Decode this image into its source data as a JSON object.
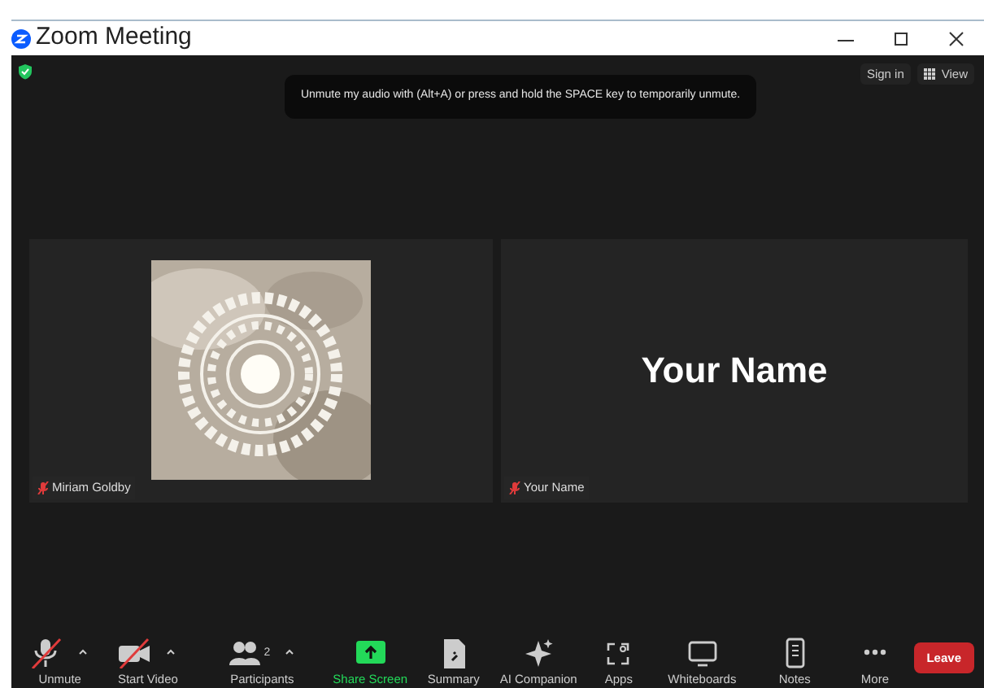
{
  "window": {
    "title": "Zoom Meeting"
  },
  "top_bar": {
    "encrypted": true,
    "sign_in": "Sign in",
    "view": "View"
  },
  "banner": "Unmute my audio with (Alt+A) or press and hold the SPACE key to temporarily unmute.",
  "tiles": [
    {
      "kind": "picture",
      "name": "Miriam Goldby",
      "muted": true
    },
    {
      "kind": "name",
      "display_name": "Your Name",
      "name": "Your Name",
      "muted": true
    }
  ],
  "toolbar": [
    {
      "kind": "mic",
      "label": "Unmute",
      "off": true,
      "has_menu": true
    },
    {
      "kind": "video",
      "label": "Start Video",
      "off": true,
      "has_menu": true
    },
    {
      "kind": "people",
      "label": "Participants",
      "count": "2",
      "has_menu": true
    },
    {
      "kind": "share",
      "label": "Share Screen",
      "color": "#23d959"
    },
    {
      "kind": "summary",
      "label": "Summary"
    },
    {
      "kind": "sparkle",
      "label": "AI Companion"
    },
    {
      "kind": "apps",
      "label": "Apps"
    },
    {
      "kind": "board",
      "label": "Whiteboards"
    },
    {
      "kind": "notes",
      "label": "Notes"
    },
    {
      "kind": "more",
      "label": "More"
    }
  ],
  "leave": "Leave"
}
